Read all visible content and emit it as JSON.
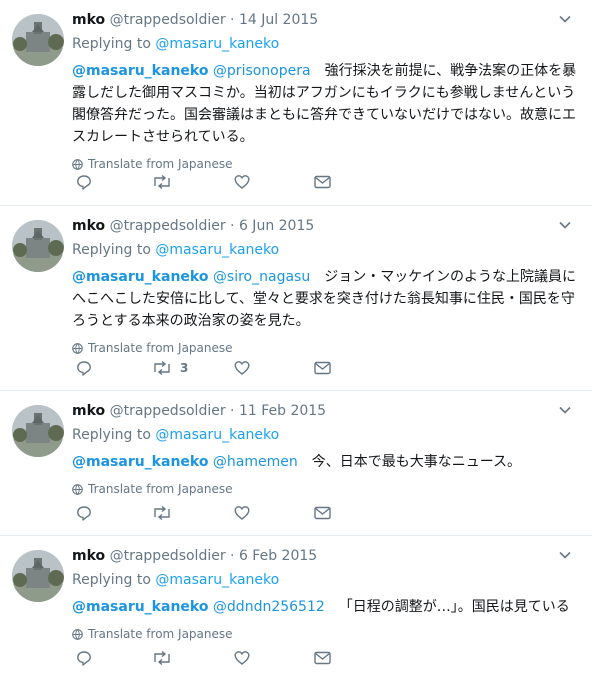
{
  "translate_label": "Translate from Japanese",
  "tweets": [
    {
      "name": "mko",
      "handle": "@trappedsoldier",
      "dot": "·",
      "date": "14 Jul 2015",
      "replying_prefix": "Replying to",
      "replying_to": "@masaru_kaneko",
      "mention_1": "@masaru_kaneko",
      "mention_2": "@prisonopera",
      "body": "強行採決を前提に、戦争法案の正体を暴露しだした御用マスコミか。当初はアフガンにもイラクにも参戦しませんという閣僚答弁だった。国会審議はまともに答弁できていないだけではない。故意にエスカレートさせられている。",
      "retweets": ""
    },
    {
      "name": "mko",
      "handle": "@trappedsoldier",
      "dot": "·",
      "date": "6 Jun 2015",
      "replying_prefix": "Replying to",
      "replying_to": "@masaru_kaneko",
      "mention_1": "@masaru_kaneko",
      "mention_2": "@siro_nagasu",
      "body": "ジョン・マッケインのような上院議員にへこへこした安倍に比して、堂々と要求を突き付けた翁長知事に住民・国民を守ろうとする本来の政治家の姿を見た。",
      "retweets": "3"
    },
    {
      "name": "mko",
      "handle": "@trappedsoldier",
      "dot": "·",
      "date": "11 Feb 2015",
      "replying_prefix": "Replying to",
      "replying_to": "@masaru_kaneko",
      "mention_1": "@masaru_kaneko",
      "mention_2": "@hamemen",
      "body": "今、日本で最も大事なニュース。",
      "retweets": ""
    },
    {
      "name": "mko",
      "handle": "@trappedsoldier",
      "dot": "·",
      "date": "6 Feb 2015",
      "replying_prefix": "Replying to",
      "replying_to": "@masaru_kaneko",
      "mention_1": "@masaru_kaneko",
      "mention_2": "@ddndn256512",
      "body": "「日程の調整が…」。国民は見ている",
      "retweets": ""
    }
  ]
}
